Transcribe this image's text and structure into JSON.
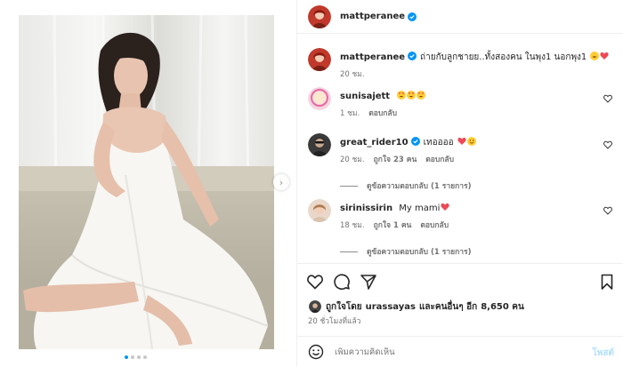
{
  "post": {
    "author": "mattperanee",
    "caption": "ถ่ายกับลูกชายย..ทั้งสองคน ในพุง1 นอกพุง1",
    "caption_time": "20 ชม."
  },
  "comments": [
    {
      "user": "sunisajett",
      "text": "",
      "time": "1 ชม.",
      "reply": "ตอบกลับ",
      "likes": "",
      "view_replies": ""
    },
    {
      "user": "great_rider10",
      "text": "เทออออ",
      "time": "20 ชม.",
      "likes": "ถูกใจ 23 คน",
      "reply": "ตอบกลับ",
      "view_replies": "ดูข้อความตอบกลับ (1 รายการ)"
    },
    {
      "user": "sirinissirin",
      "text": "My mami",
      "time": "18 ชม.",
      "likes": "ถูกใจ 1 คน",
      "reply": "ตอบกลับ",
      "view_replies": "ดูข้อความตอบกลับ (1 รายการ)"
    }
  ],
  "likes_summary": {
    "prefix": "ถูกใจโดย",
    "user": "urassayas",
    "middle": "และคนอื่นๆ อีก",
    "count": "8,650 คน"
  },
  "time_ago": "20 ชั่วโมงที่แล้ว",
  "composer": {
    "placeholder": "เพิ่มความคิดเห็น",
    "post_label": "โพสต์"
  },
  "carousel": {
    "slides": 4,
    "active_index": 0
  },
  "colors": {
    "verified": "#0095f6",
    "heart": "#ed4956",
    "post_disabled": "#b2dffc"
  },
  "icons": [
    "verified-badge-icon",
    "heart-icon",
    "comment-icon",
    "share-icon",
    "bookmark-icon",
    "emoji-icon",
    "chevron-right-icon"
  ]
}
